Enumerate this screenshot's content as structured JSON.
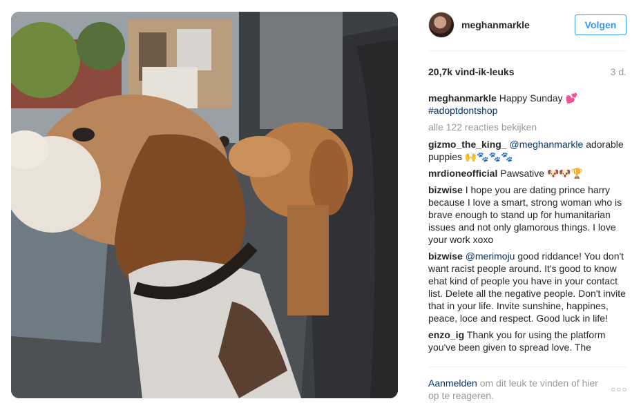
{
  "post": {
    "username": "meghanmarkle",
    "follow_label": "Volgen",
    "likes": "20,7k vind-ik-leuks",
    "age": "3 d."
  },
  "caption": {
    "user": "meghanmarkle",
    "text": "Happy Sunday 💕",
    "hashtag": "#adoptdontshop"
  },
  "view_all_comments": "alle 122 reacties bekijken",
  "comments": [
    {
      "user": "gizmo_the_king_",
      "mention": "@meghanmarkle",
      "text": "adorable puppies 🙌🐾🐾🐾"
    },
    {
      "user": "mrdioneofficial",
      "text": "Pawsative 🐶🐶🏆"
    },
    {
      "user": "bizwise",
      "text": "I hope you are dating prince harry because I love a smart, strong woman who is brave enough to stand up for humanitarian issues and not only glamorous things. I love your work xoxo"
    },
    {
      "user": "bizwise",
      "mention": "@merimoju",
      "text": "good riddance! You don't want racist people around. It's good to know ehat kind of people you have in your contact list. Delete all the negative people. Don't invite that in your life. Invite sunshine, happines, peace, loce and respect. Good luck in life!"
    },
    {
      "user": "enzo_ig",
      "text": "Thank you for using the platform you've been given to spread love. The"
    }
  ],
  "footer": {
    "login_label": "Aanmelden",
    "text": "om dit leuk te vinden of hier op te reageren.",
    "more_icon": "ellipsis-icon"
  }
}
